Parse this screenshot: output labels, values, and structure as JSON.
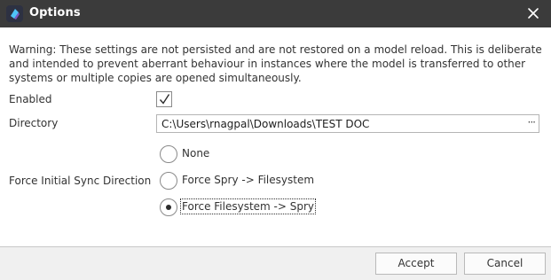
{
  "window": {
    "title": "Options",
    "titlebar_color": "#3b3b3b",
    "close_icon": "close-icon",
    "app_icon": "spry-logo"
  },
  "warning_text": "Warning: These settings are not persisted and are not restored on a model reload. This is deliberate and intended to prevent aberrant behaviour in instances where the model is transferred to other systems or multiple copies are opened simultaneously.",
  "enabled": {
    "label": "Enabled",
    "checked": true
  },
  "directory": {
    "label": "Directory",
    "value": "C:\\Users\\rnagpal\\Downloads\\TEST DOC",
    "browse_label": "···"
  },
  "sync_direction": {
    "label": "Force Initial Sync Direction",
    "options": [
      {
        "label": "None",
        "selected": false
      },
      {
        "label": "Force Spry -> Filesystem",
        "selected": false
      },
      {
        "label": "Force Filesystem -> Spry",
        "selected": true
      }
    ]
  },
  "buttons": {
    "accept": "Accept",
    "cancel": "Cancel"
  }
}
